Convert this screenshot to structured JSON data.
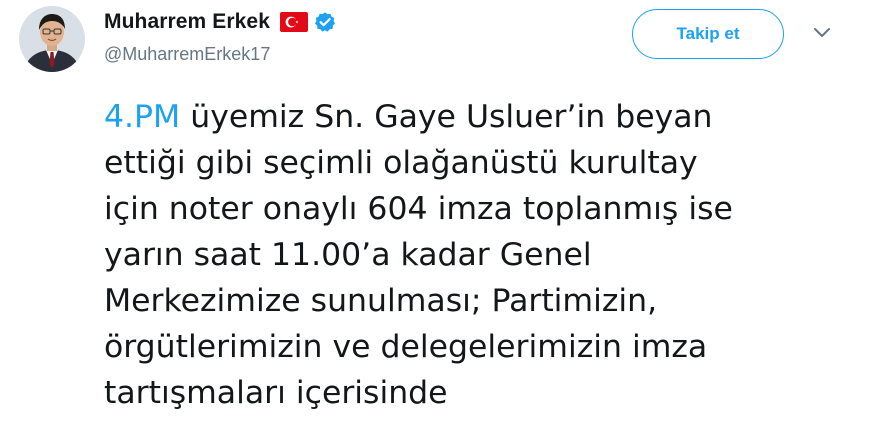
{
  "author": {
    "display_name": "Muharrem Erkek",
    "handle": "@MuharremErkek17",
    "flag_icon": "turkey-flag-icon",
    "verified_icon": "verified-badge-icon"
  },
  "actions": {
    "follow_label": "Takip et",
    "more_icon": "chevron-down-icon"
  },
  "tweet": {
    "mention": "4.PM",
    "lines": [
      " üyemiz Sn. Gaye Usluer’in beyan",
      "ettiği gibi seçimli olağanüstü kurultay",
      "için noter onaylı 604 imza toplanmış ise",
      "yarın saat 11.00’a kadar Genel",
      "Merkezimize sunulması; Partimizin,",
      "örgütlerimizin ve delegelerimizin imza",
      "tartışmaları içerisinde"
    ]
  },
  "colors": {
    "accent": "#1da1f2",
    "text": "#14171a",
    "secondary": "#657786",
    "flag_red": "#e30a17"
  }
}
